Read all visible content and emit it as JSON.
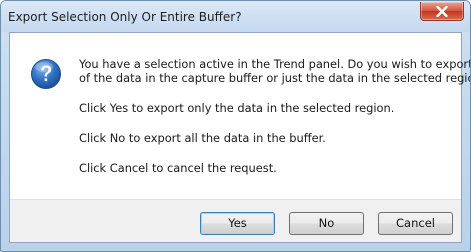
{
  "dialog": {
    "title": "Export Selection Only Or Entire Buffer?",
    "close_icon": "close-icon",
    "info_icon": "question-mark-icon",
    "message_lines": [
      "You have a selection active in the Trend panel. Do you wish to export all",
      "of the data in the capture buffer or just the data in the selected region?"
    ],
    "yes_hint": "Click Yes to export only the data in the selected region.",
    "no_hint": "Click No to export all the data in the buffer.",
    "cancel_hint": "Click Cancel to cancel the request."
  },
  "buttons": {
    "yes": "Yes",
    "no": "No",
    "cancel": "Cancel"
  },
  "colors": {
    "accent": "#2e6fc2",
    "close": "#c4361f"
  }
}
